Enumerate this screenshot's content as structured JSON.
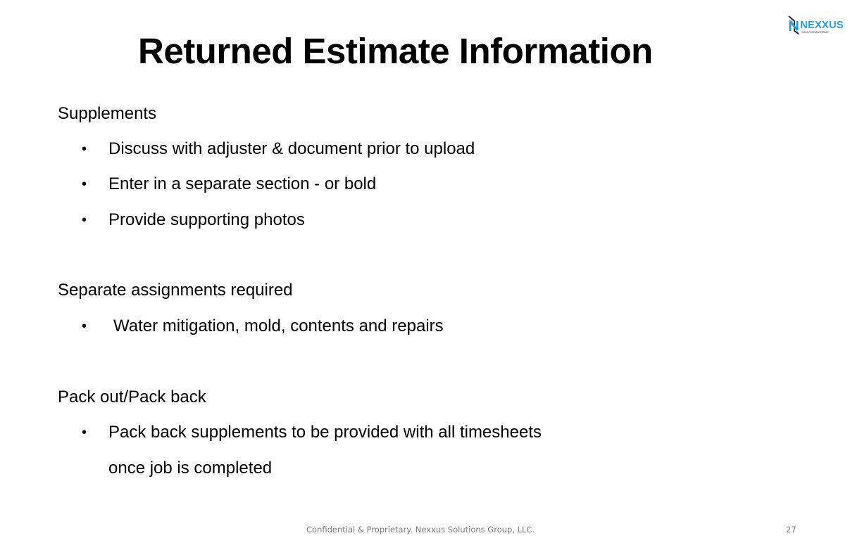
{
  "slide": {
    "title": "Returned Estimate Information",
    "logo": {
      "name": "NEXXUS",
      "tagline": "SOLUTIONS GROUP",
      "colors": {
        "primary": "#2a9fd8",
        "dark": "#1f2a3a"
      }
    },
    "sections": [
      {
        "heading": "Supplements",
        "bullets": [
          "Discuss with adjuster & document prior to upload",
          "Enter in a separate section - or bold",
          "Provide supporting photos"
        ]
      },
      {
        "heading": "Separate assignments required",
        "bullets": [
          "Water mitigation, mold, contents and repairs"
        ]
      },
      {
        "heading": "Pack out/Pack back",
        "bullets": [
          "Pack back supplements to be provided with all timesheets",
          "once job is completed"
        ]
      }
    ],
    "bullet_glyph": "•",
    "footer": "Confidential & Proprietary.  Nexxus Solutions Group, LLC.",
    "page_number": "27"
  }
}
